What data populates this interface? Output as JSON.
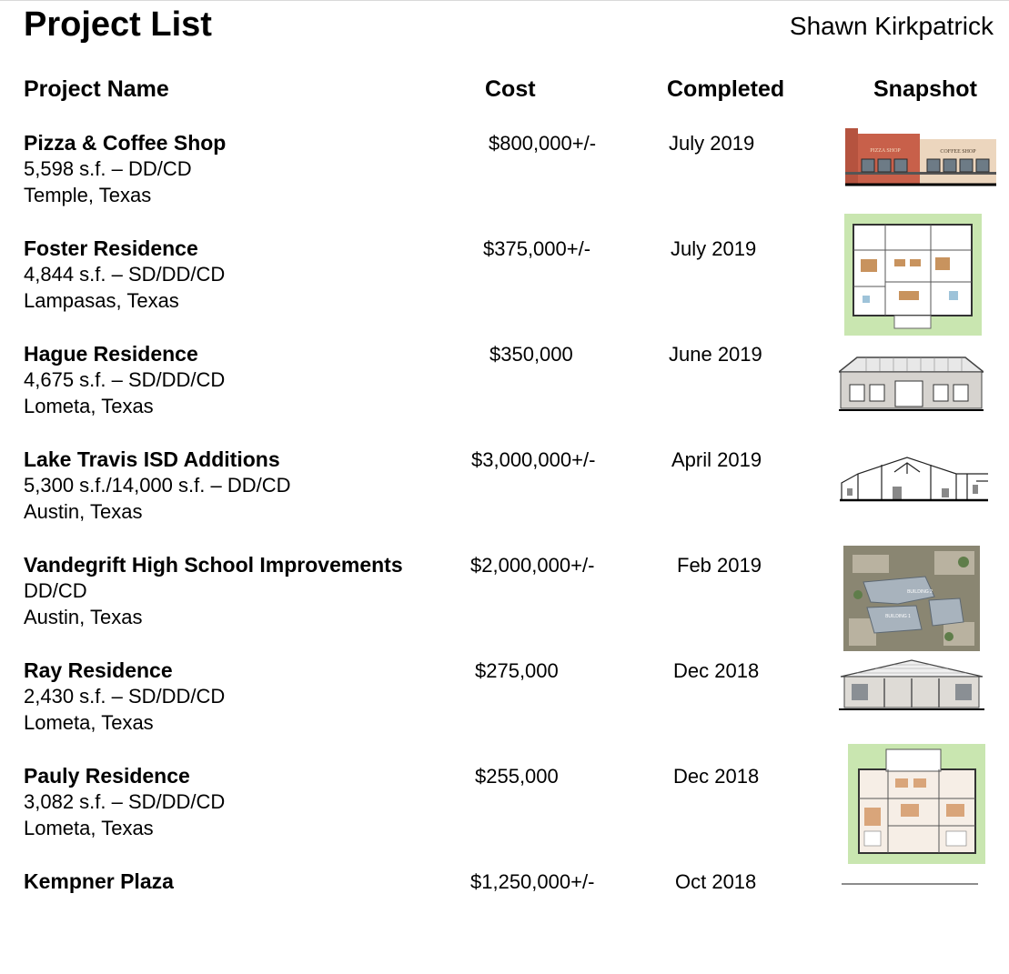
{
  "page": {
    "title": "Project List",
    "author": "Shawn Kirkpatrick"
  },
  "columns": {
    "name": "Project Name",
    "cost": "Cost",
    "completed": "Completed",
    "snapshot": "Snapshot"
  },
  "projects": [
    {
      "name": "Pizza & Coffee Shop",
      "area": "5,598 s.f. – DD/CD",
      "location": "Temple, Texas",
      "cost": "$800,000+/-",
      "completed": "July 2019",
      "snapshot": "storefront-elevation",
      "sign_left": "PIZZA SHOP",
      "sign_right": "COFFEE SHOP"
    },
    {
      "name": "Foster Residence",
      "area": "4,844 s.f. – SD/DD/CD",
      "location": "Lampasas, Texas",
      "cost": "$375,000+/-",
      "completed": "July 2019",
      "snapshot": "floor-plan"
    },
    {
      "name": "Hague Residence",
      "area": "4,675 s.f. – SD/DD/CD",
      "location": "Lometa, Texas",
      "cost": "$350,000",
      "completed": "June 2019",
      "snapshot": "house-elevation"
    },
    {
      "name": "Lake Travis ISD Additions",
      "area": "5,300 s.f./14,000 s.f. – DD/CD",
      "location": "Austin, Texas",
      "cost": "$3,000,000+/-",
      "completed": "April 2019",
      "snapshot": "building-section"
    },
    {
      "name": "Vandegrift High School Improvements",
      "area": "DD/CD",
      "location": "Austin, Texas",
      "cost": "$2,000,000+/-",
      "completed": "Feb 2019",
      "snapshot": "aerial-site-plan",
      "site_label_1": "BUILDING 2",
      "site_label_2": "BUILDING 1"
    },
    {
      "name": "Ray Residence",
      "area": "2,430 s.f. – SD/DD/CD",
      "location": "Lometa, Texas",
      "cost": "$275,000",
      "completed": "Dec 2018",
      "snapshot": "house-elevation"
    },
    {
      "name": "Pauly Residence",
      "area": "3,082 s.f. – SD/DD/CD",
      "location": "Lometa, Texas",
      "cost": "$255,000",
      "completed": "Dec 2018",
      "snapshot": "floor-plan"
    },
    {
      "name": "Kempner Plaza",
      "area": "",
      "location": "",
      "cost": "$1,250,000+/-",
      "completed": "Oct 2018",
      "snapshot": "elevation"
    }
  ],
  "colors": {
    "text": "#000000",
    "brick": "#c8604a",
    "stucco": "#ecd6be",
    "plan_green": "#c9e6b0",
    "aerial": "#8a8672"
  }
}
